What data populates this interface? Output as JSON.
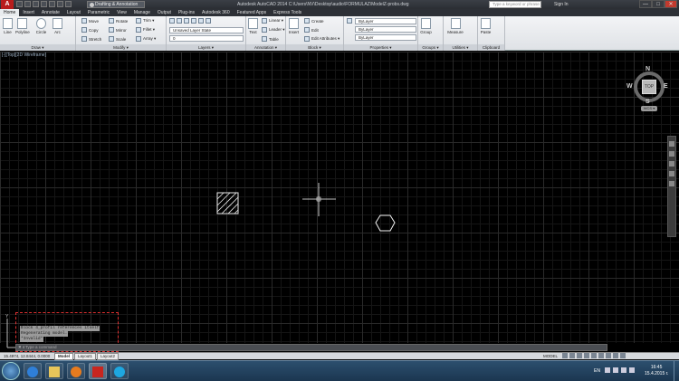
{
  "titlebar": {
    "workspace": "Drafting & Annotation",
    "title": "Autodesk AutoCAD 2014    C:\\Users\\NV\\Desktop\\audio\\FORMULAZ\\ModelZ-probs.dwg",
    "search_placeholder": "Type a keyword or phrase",
    "signin": "Sign In",
    "minimize": "—",
    "maximize": "□",
    "close": "✕"
  },
  "tabs": [
    "Home",
    "Insert",
    "Annotate",
    "Layout",
    "Parametric",
    "View",
    "Manage",
    "Output",
    "Plug-ins",
    "Autodesk 360",
    "Featured Apps",
    "Express Tools"
  ],
  "ribbon": {
    "draw": {
      "title": "Draw ▾",
      "line": "Line",
      "polyline": "Polyline",
      "circle": "Circle",
      "arc": "Arc"
    },
    "modify": {
      "title": "Modify ▾",
      "move": "Move",
      "rotate": "Rotate",
      "trim": "Trim ▾",
      "copy": "Copy",
      "mirror": "Mirror",
      "fillet": "Fillet ▾",
      "stretch": "Stretch",
      "scale": "Scale",
      "array": "Array ▾"
    },
    "layers": {
      "title": "Layers ▾",
      "layer_state": "Unsaved Layer State",
      "current_layer": "0"
    },
    "annotation": {
      "title": "Annotation ▾",
      "text": "Text",
      "linear": "Linear ▾",
      "leader": "Leader ▾",
      "table": "Table"
    },
    "block": {
      "title": "Block ▾",
      "insert": "Insert",
      "create": "Create",
      "edit": "Edit",
      "edit_attributes": "Edit Attributes ▾"
    },
    "properties": {
      "title": "Properties ▾",
      "color": "ByLayer",
      "linetype": "ByLayer",
      "lineweight": "ByLayer"
    },
    "groups": {
      "title": "Groups ▾",
      "group": "Group"
    },
    "utilities": {
      "title": "Utilities ▾",
      "measure": "Measure"
    },
    "clipboard": {
      "title": "Clipboard",
      "paste": "Paste"
    }
  },
  "viewport_label": "[-][Top][2D Wireframe]",
  "viewcube": {
    "top": "TOP",
    "n": "N",
    "s": "S",
    "e": "E",
    "w": "W",
    "wcs": "WCS ▾"
  },
  "command": {
    "history": [
      "Block 4_profil references itself",
      "Regenerating model.",
      "*Invalid*"
    ],
    "placeholder": "Type a command"
  },
  "layout_bar": {
    "coords": "15.4974, 12.8444, 0.0000",
    "tabs": [
      "Model",
      "Layout1",
      "Layout2"
    ],
    "model_label": "MODEL"
  },
  "taskbar": {
    "lang": "EN",
    "time": "16:45",
    "date": "15.4.2015 г."
  }
}
